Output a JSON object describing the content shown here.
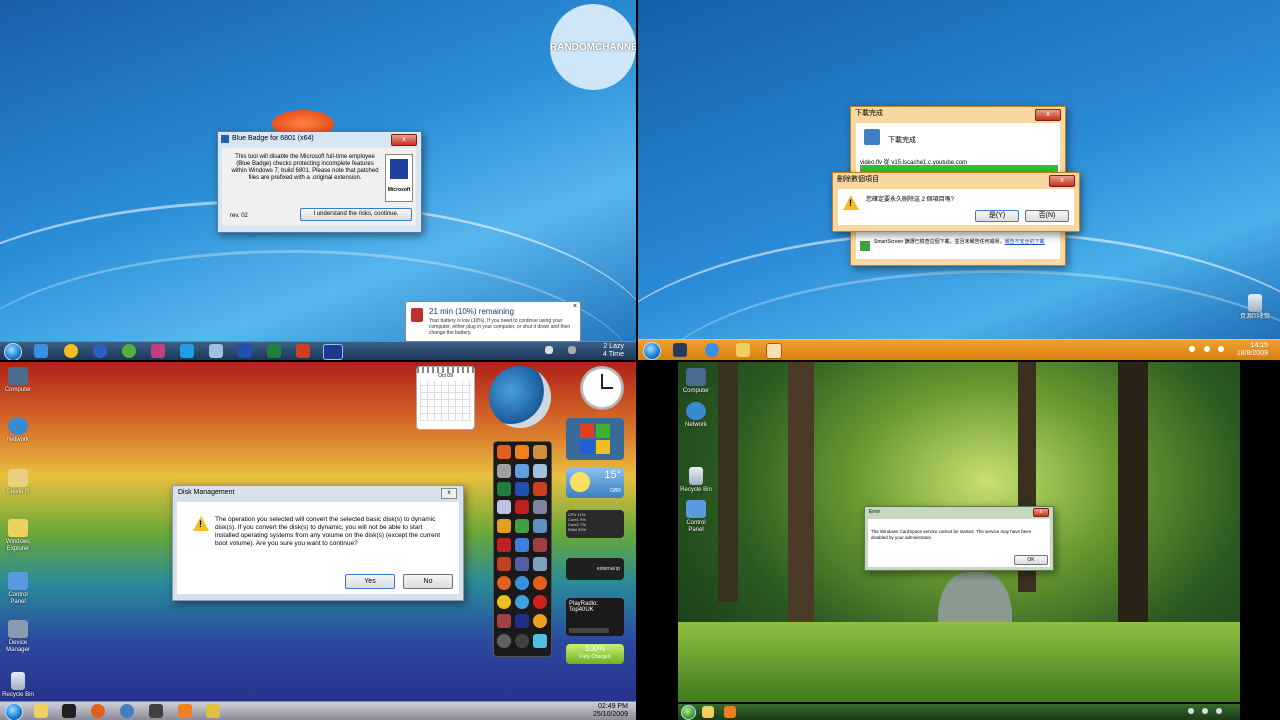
{
  "channel": {
    "badge_text": "RANDOMCHANNEL"
  },
  "q1": {
    "dialog": {
      "title": "Blue Badge for 6801 (x64)",
      "message": "This tool will disable the Microsoft full-time employee (Blue Badge) checks protecting incomplete features within Windows 7, build 6801. Please note that patched files are prefixed with a .original extension.",
      "version": "rev. 02",
      "button": "I understand the risks, continue.",
      "badge_logo": "Microsoft"
    },
    "battery": {
      "title": "21 min (10%) remaining",
      "message": "Your battery is low (10%). If you need to continue using your computer, either plug in your computer, or shut it down and then change the battery."
    },
    "clock": {
      "line1": "2 Lazy",
      "line2": "4 Time"
    }
  },
  "q2": {
    "download": {
      "title": "下載完成",
      "heading": "下載完成",
      "file": "video.flv 從 v15.lscache1.c.youtube.com"
    },
    "confirm": {
      "title": "刪除數個項目",
      "message": "您確定要永久刪除這 2 個項目嗎?",
      "yes": "是(Y)",
      "no": "否(N)"
    },
    "footer": {
      "text": "SmartScreen 篩選已檢查這個下載，並且未報告任何威脅。",
      "link": "報告不安全的下載"
    },
    "recycle": {
      "label": "資源回收筒"
    },
    "clock": {
      "time": "14:15",
      "date": "18/8/2009"
    }
  },
  "q3": {
    "icons": [
      "Computer",
      "Network",
      "Stevie R",
      "Windows Explorer",
      "Control Panel",
      "Device Manager",
      "Recycle Bin"
    ],
    "dialog": {
      "title": "Disk Management",
      "message": "The operation you selected will convert the selected basic disk(s) to dynamic disk(s). If you convert the disk(s) to dynamic, you will not be able to start installed operating systems from any volume on the disk(s) (except the current boot volume). Are you sure you want to continue?",
      "yes": "Yes",
      "no": "No"
    },
    "calendar": {
      "month": "Oct 09"
    },
    "weather": {
      "temp": "15°",
      "loc": "GBR"
    },
    "meter": {
      "line1": "CPU 11%",
      "line2": "Core1 9%",
      "line3": "Core2 7%",
      "line4": "RAM 33%"
    },
    "external": {
      "label": "external ip"
    },
    "radio": {
      "title": "PlayRadio:",
      "station": "Top40UK"
    },
    "battery": {
      "pct": "100%",
      "state": "Fully Charged"
    },
    "clock": {
      "time": "02:49 PM",
      "date": "25/10/2009"
    }
  },
  "q4": {
    "icons": [
      "Computer",
      "Network",
      "Recycle Bin",
      "Control Panel"
    ],
    "dialog": {
      "title": "Error",
      "message": "The Windows CardSpace service cannot be started. The service may have been disabled by your administrator.",
      "ok": "OK"
    }
  }
}
